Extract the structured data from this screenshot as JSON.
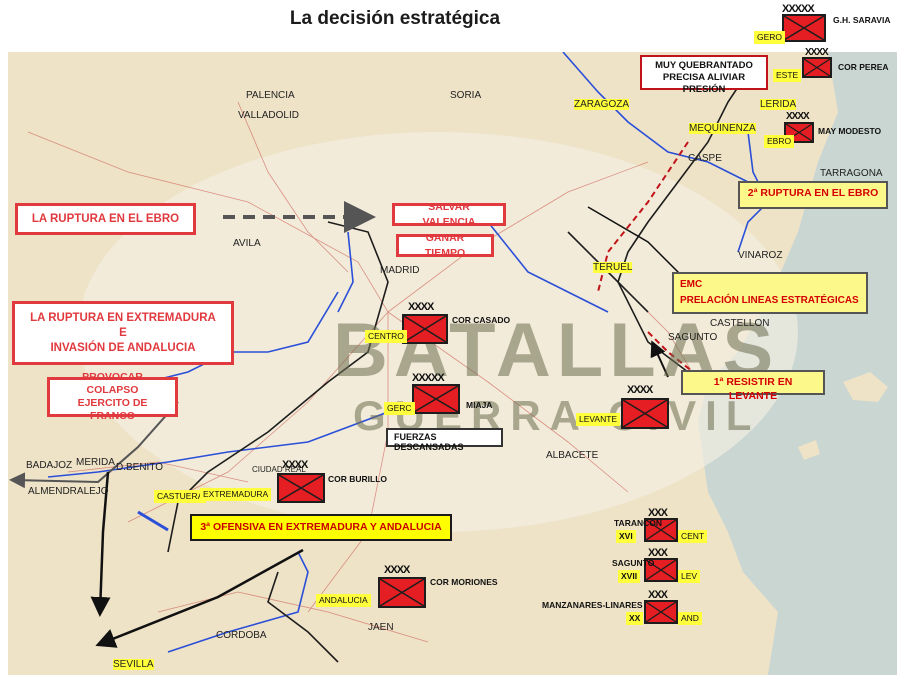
{
  "title": "La decisión estratégica",
  "colors": {
    "unit_fill": "#e41e22",
    "callout_red": "#e0393e",
    "callout_yellow": "#ffff00",
    "map_base": "#eee2c7"
  },
  "watermark": {
    "logo": "BATALLAS",
    "sub": "GUERRA CIVIL"
  },
  "map_labels": {
    "valladolid": "VALLADOLID",
    "soria": "SORIA",
    "zaragoza": "ZARAGOZA",
    "lerida": "LERIDA",
    "mequinenza": "MEQUINENZA",
    "caspe": "CASPE",
    "tarragona": "TARRAGONA",
    "madrid": "MADRID",
    "teruel": "TERUEL",
    "vinaroz": "VINAROZ",
    "castellon": "CASTELLON",
    "sagunto": "SAGUNTO",
    "albacete": "ALBACETE",
    "badajoz": "BADAJOZ",
    "merida": "MERIDA",
    "don_benito": "D.BENITO",
    "almendralejo": "ALMENDRALEJO",
    "ciudad_real": "CIUDAD REAL",
    "cordoba": "CORDOBA",
    "jaen": "JAEN",
    "sevilla": "SEVILLA",
    "avila": "AVILA",
    "palencia": "PALENCIA"
  },
  "callouts": {
    "ruptura_ebro": "LA RUPTURA EN EL EBRO",
    "ruptura_extremadura": [
      "LA RUPTURA EN EXTREMADURA",
      "E",
      "INVASIÓN DE ANDALUCIA"
    ],
    "provocar_colapso": [
      "PROVOCAR COLAPSO",
      "EJERCITO DE FRANCO"
    ],
    "salvar_valencia": "SALVAR VALENCIA",
    "ganar_tiempo": "GANAR TIEMPO",
    "muy_quebrantado": [
      "MUY QUEBRANTADO",
      "PRECISA ALIVIAR PRESIÓN"
    ],
    "segunda_ruptura": "2ª RUPTURA EN EL EBRO",
    "emc": [
      "EMC",
      "PRELACIÓN LINEAS ESTRATÉGICAS"
    ],
    "resistir_levante": "1ª RESISTIR EN LEVANTE",
    "fuerzas_descansadas": "FUERZAS DESCANSADAS",
    "tercera_ofensiva": "3ª OFENSIVA EN EXTREMADURA Y ANDALUCIA"
  },
  "units": {
    "gero": {
      "tag": "GERO",
      "echelon": "XXXXX",
      "commander": "G.H. SARAVIA"
    },
    "este": {
      "tag": "ESTE",
      "echelon": "XXXX",
      "commander": "COR PEREA"
    },
    "ebro": {
      "tag": "EBRO",
      "echelon": "XXXX",
      "commander": "MAY MODESTO"
    },
    "centro": {
      "tag": "CENTRO",
      "echelon": "XXXX",
      "commander": "COR CASADO"
    },
    "gerc": {
      "tag": "GERC",
      "echelon": "XXXXX",
      "commander": "MIAJA"
    },
    "levante": {
      "tag": "LEVANTE",
      "echelon": "XXXX",
      "commander": ""
    },
    "extremadura": {
      "tag": "EXTREMADURA",
      "echelon": "XXXX",
      "commander": "COR BURILLO"
    },
    "andalucia": {
      "tag": "ANDALUCIA",
      "echelon": "XXXX",
      "commander": "COR MORIONES"
    },
    "xvi": {
      "place": "TARANCON",
      "corps": "XVI",
      "echelon": "XXX",
      "army": "CENT"
    },
    "xvii": {
      "place": "SAGUNTO",
      "corps": "XVII",
      "echelon": "XXX",
      "army": "LEV"
    },
    "xx": {
      "place": "MANZANARES-LINARES",
      "corps": "XX",
      "echelon": "XXX",
      "army": "AND"
    }
  },
  "place_tags": {
    "castuera": "CASTUERA"
  }
}
